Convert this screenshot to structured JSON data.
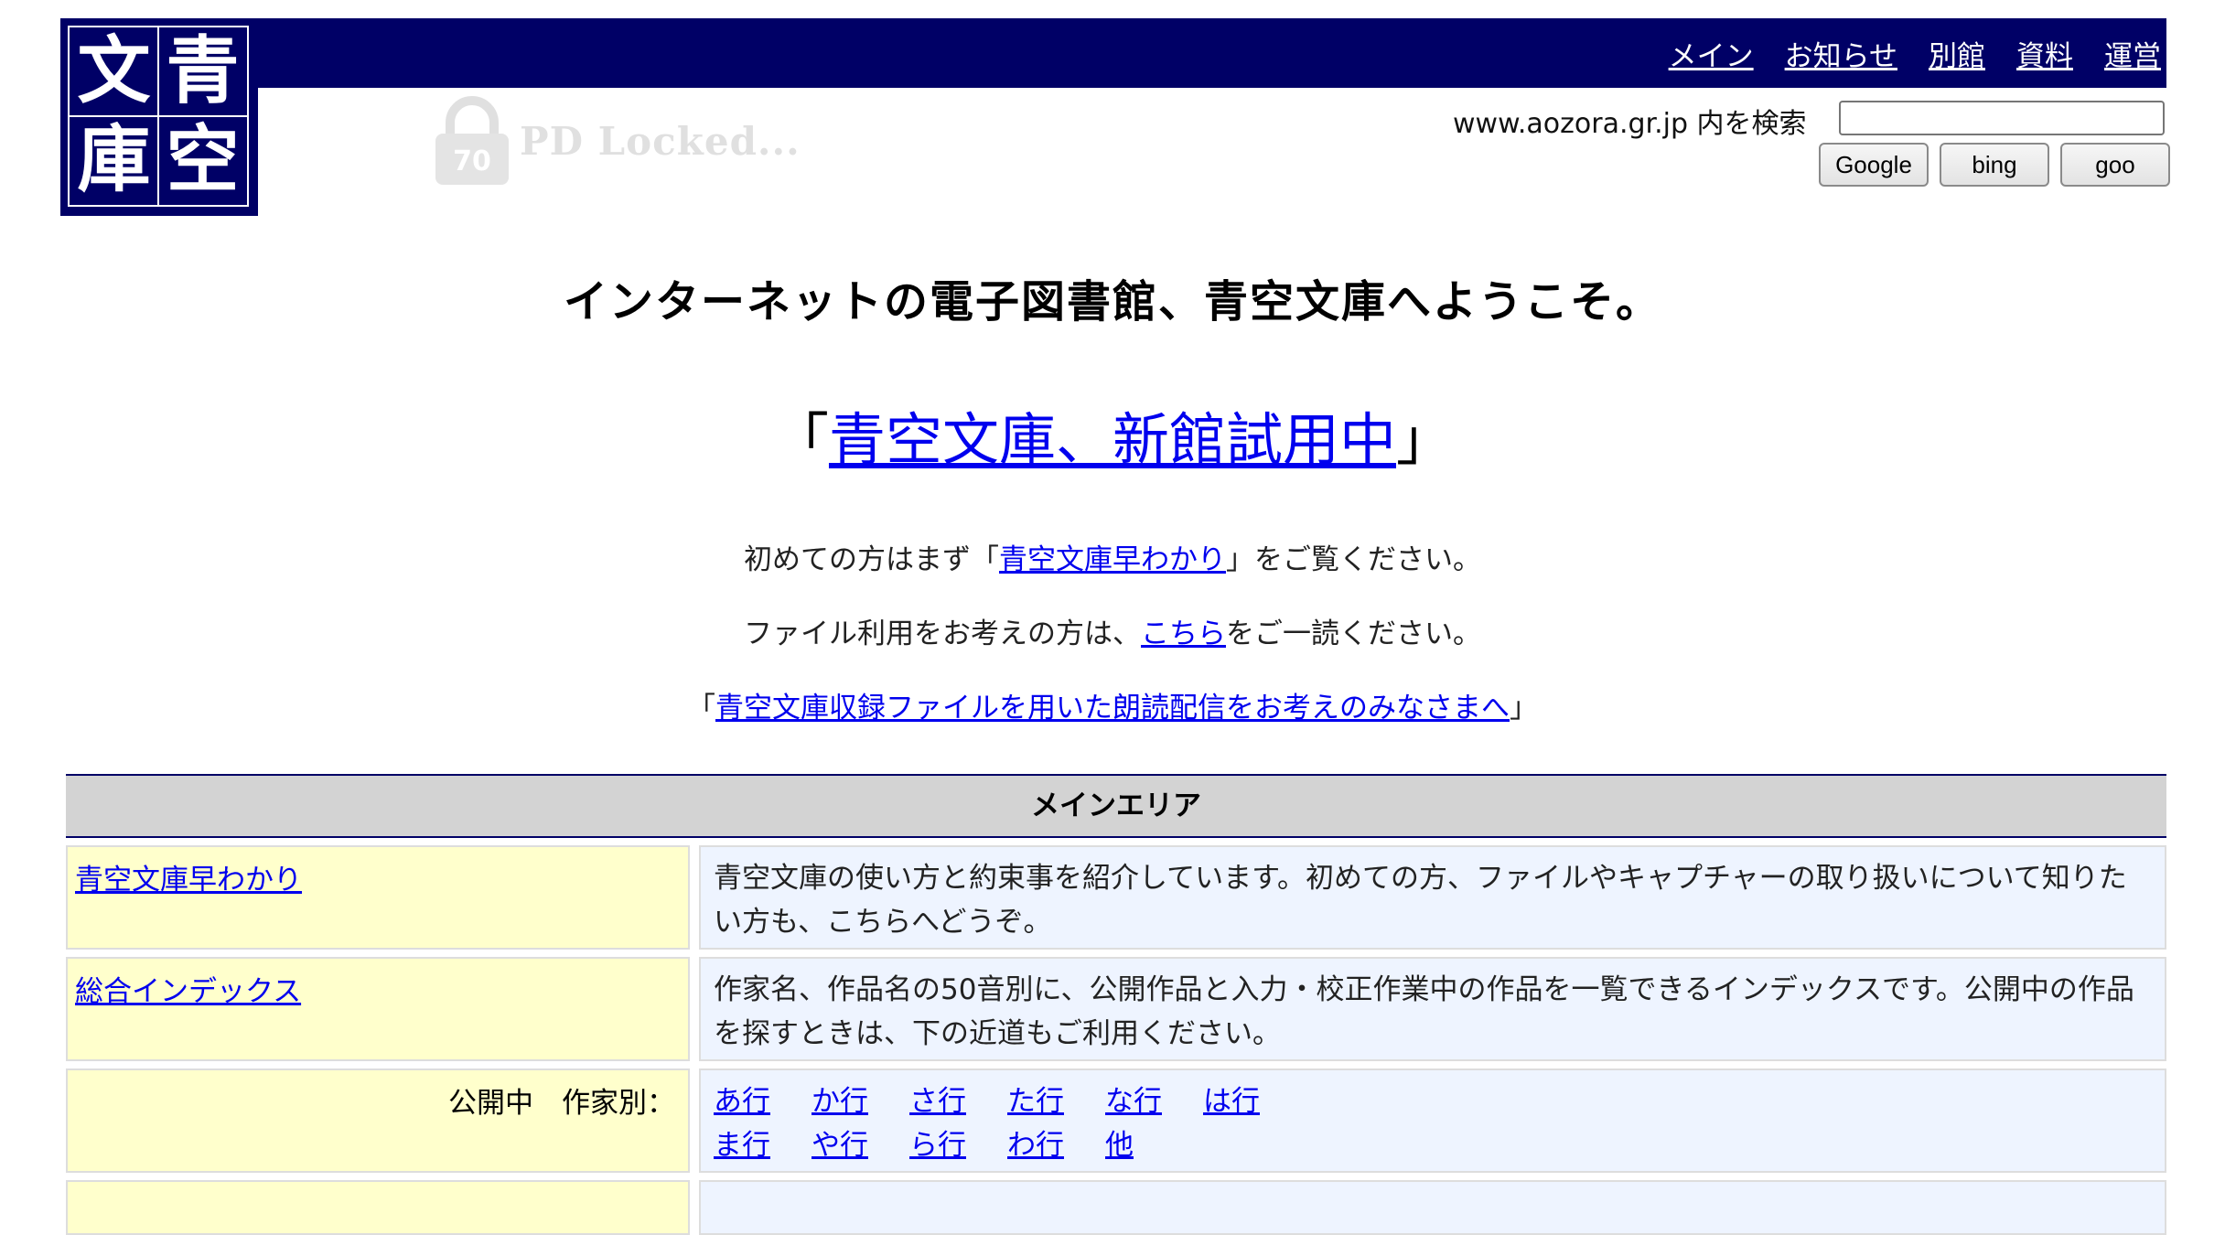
{
  "logo": {
    "chars": [
      "文",
      "青",
      "庫",
      "空"
    ]
  },
  "watermark": {
    "badge": "70",
    "text": "PD Locked..."
  },
  "nav": {
    "items": [
      "メイン",
      "お知らせ",
      "別館",
      "資料",
      "運営"
    ]
  },
  "search": {
    "label": "www.aozora.gr.jp 内を検索",
    "value": "",
    "buttons": [
      "Google",
      "bing",
      "goo"
    ]
  },
  "welcome": "インターネットの電子図書館、青空文庫へようこそ。",
  "newhall": {
    "open": "「",
    "link": "青空文庫、新館試用中",
    "close": "」"
  },
  "intro": {
    "line1": {
      "before": "初めての方はまず「",
      "link": "青空文庫早わかり",
      "after": "」をご覧ください。"
    },
    "line2": {
      "before": "ファイル利用をお考えの方は、",
      "link": "こちら",
      "after": "をご一読ください。"
    },
    "line3": {
      "before": "「",
      "link": "青空文庫収録ファイルを用いた朗読配信をお考えのみなさまへ",
      "after": "」"
    }
  },
  "mainarea": {
    "title": "メインエリア",
    "rows": [
      {
        "link": "青空文庫早わかり",
        "desc": "青空文庫の使い方と約束事を紹介しています。初めての方、ファイルやキャプチャーの取り扱いについて知りたい方も、こちらへどうぞ。"
      },
      {
        "link": "総合インデックス",
        "desc": "作家名、作品名の50音別に、公開作品と入力・校正作業中の作品を一覧できるインデックスです。公開中の作品を探すときは、下の近道もご利用ください。"
      }
    ],
    "author_row": {
      "label": "公開中　作家別：",
      "links": [
        "あ行",
        "か行",
        "さ行",
        "た行",
        "な行",
        "は行",
        "ま行",
        "や行",
        "ら行",
        "わ行",
        "他"
      ]
    }
  },
  "colors": {
    "navy": "#000066",
    "link": "#0000ee",
    "left_cell": "#ffffcc",
    "right_cell": "#eef4ff",
    "header_gray": "#d3d3d3"
  }
}
